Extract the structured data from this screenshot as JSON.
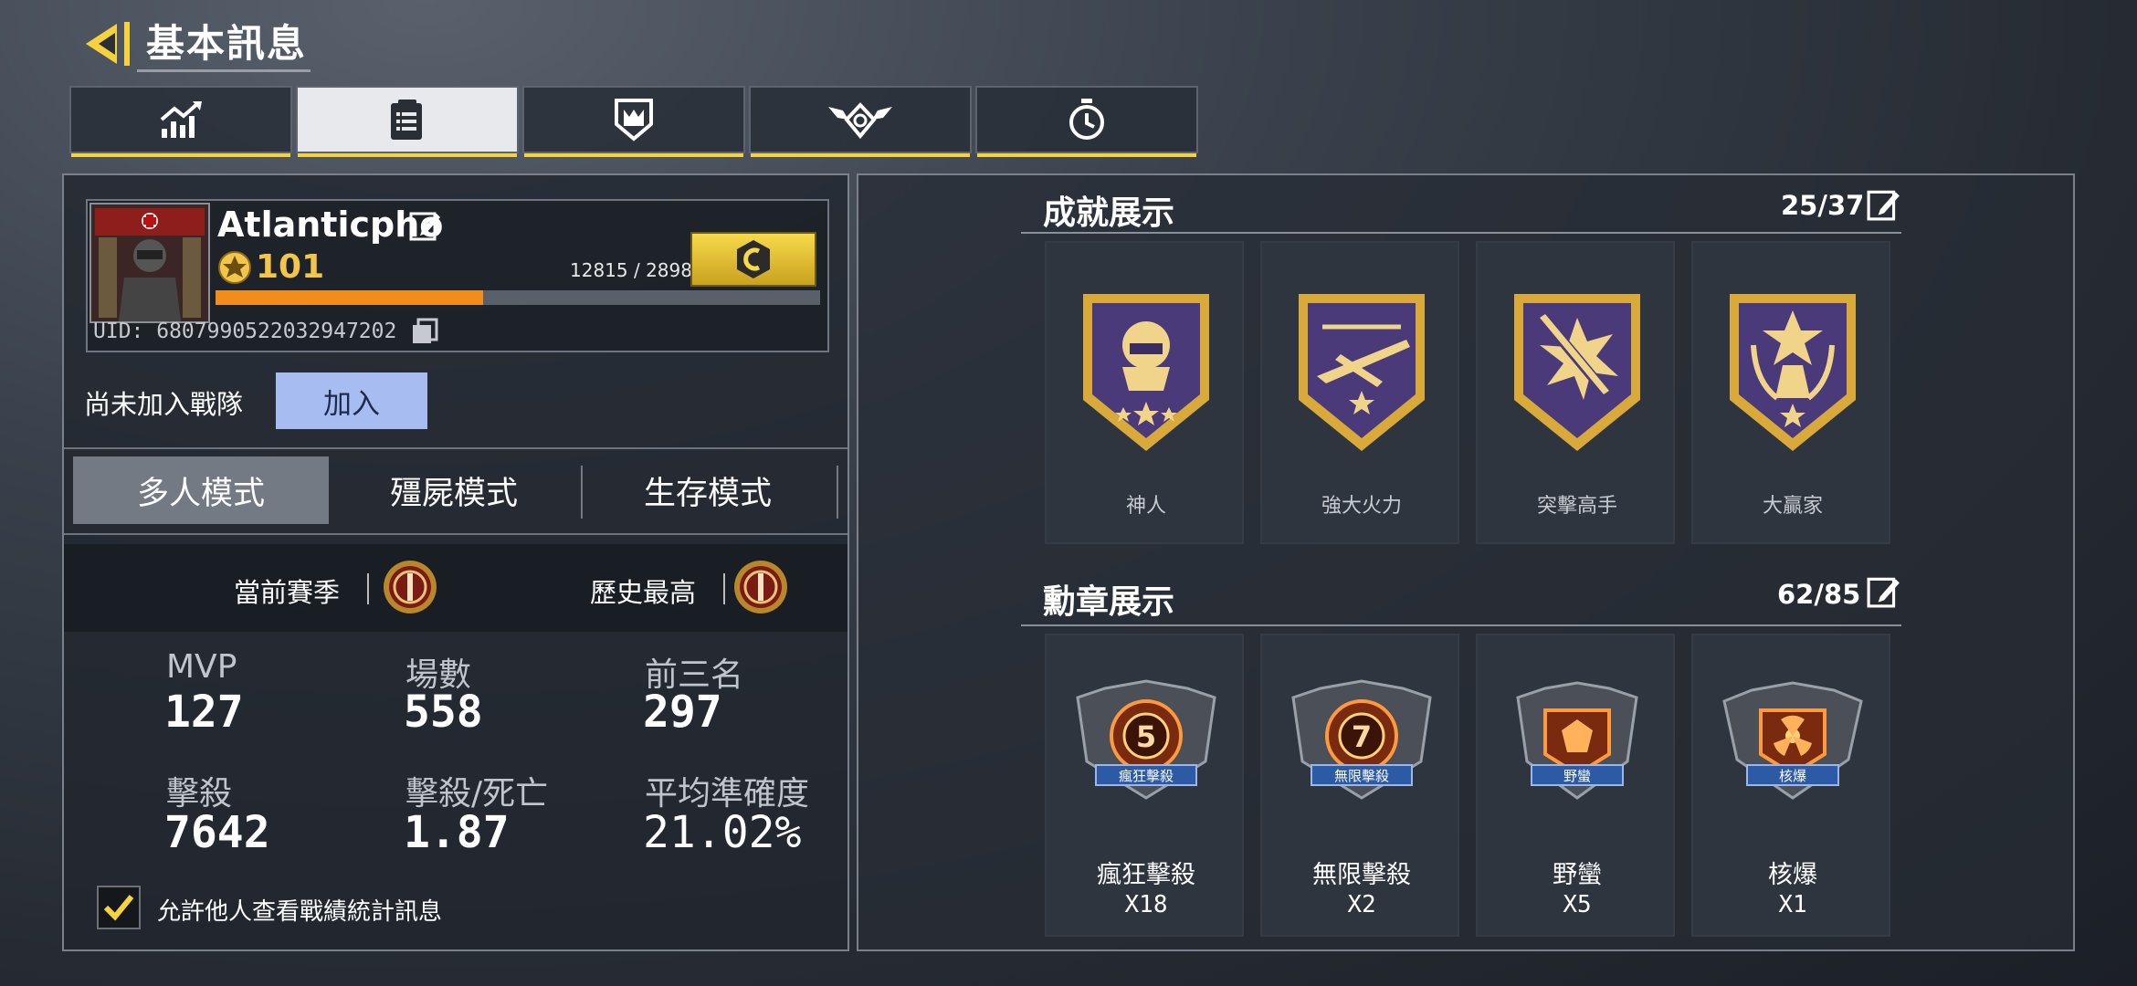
{
  "header": {
    "title": "基本訊息"
  },
  "tabs": [
    {
      "icon": "stats-chart-icon",
      "active": false
    },
    {
      "icon": "clipboard-icon",
      "active": true
    },
    {
      "icon": "shield-badge-icon",
      "active": false
    },
    {
      "icon": "winged-emblem-icon",
      "active": false
    },
    {
      "icon": "stopwatch-icon",
      "active": false
    }
  ],
  "profile": {
    "name": "Atlanticpho",
    "level": "101",
    "xp_text": "12815 / 28980",
    "xp_progress": 0.4422,
    "uid": "UID: 6807990522032947202",
    "clan_label": "尚未加入戰隊",
    "join_label": "加入"
  },
  "modes": [
    "多人模式",
    "殭屍模式",
    "生存模式"
  ],
  "season": {
    "current_label": "當前賽季",
    "best_label": "歷史最高"
  },
  "stats": [
    {
      "label": "MVP",
      "value": "127"
    },
    {
      "label": "場數",
      "value": "558"
    },
    {
      "label": "前三名",
      "value": "297"
    },
    {
      "label": "擊殺",
      "value": "7642"
    },
    {
      "label": "擊殺/死亡",
      "value": "1.87"
    },
    {
      "label": "平均準確度",
      "value": "21.02%"
    }
  ],
  "allow_stats": {
    "label": "允許他人查看戰績統計訊息",
    "checked": true
  },
  "achievements": {
    "title": "成就展示",
    "count": "25/37",
    "items": [
      {
        "label": "神人",
        "icon": "skull-helmet-icon"
      },
      {
        "label": "強大火力",
        "icon": "aircraft-icon"
      },
      {
        "label": "突擊高手",
        "icon": "rifle-burst-icon"
      },
      {
        "label": "大贏家",
        "icon": "trophy-star-icon"
      }
    ]
  },
  "medals": {
    "title": "勳章展示",
    "count": "62/85",
    "items": [
      {
        "label": "瘋狂擊殺",
        "banner": "瘋狂擊殺",
        "count": "X18",
        "emblem": "5"
      },
      {
        "label": "無限擊殺",
        "banner": "無限擊殺",
        "count": "X2",
        "emblem": "7"
      },
      {
        "label": "野蠻",
        "banner": "野蠻",
        "count": "X5",
        "emblem": ""
      },
      {
        "label": "核爆",
        "banner": "核爆",
        "count": "X1",
        "emblem": ""
      }
    ]
  },
  "colors": {
    "accent": "#f6d33c",
    "xp": "#f28d1c",
    "join": "#a7bdf2",
    "medal_purple": "#4b3a7a",
    "medal_gold": "#d9a93a"
  }
}
